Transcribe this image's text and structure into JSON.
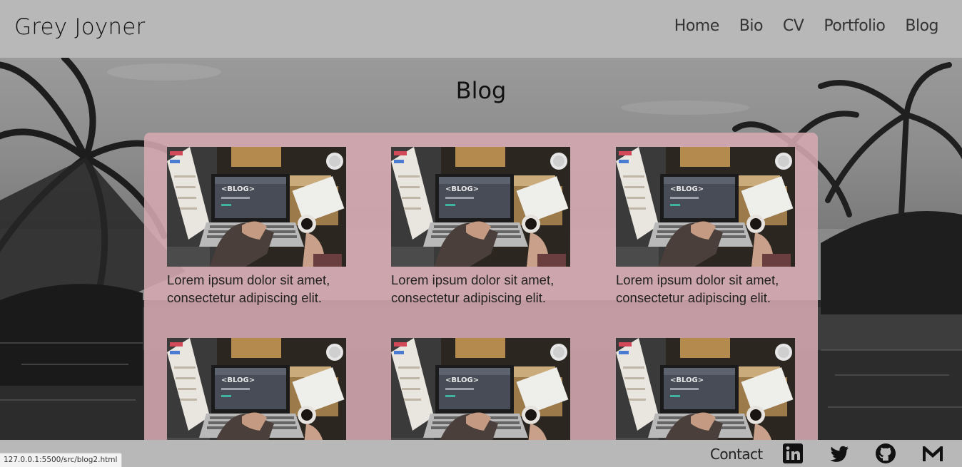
{
  "header": {
    "brand": "Grey Joyner",
    "nav": [
      "Home",
      "Bio",
      "CV",
      "Portfolio",
      "Blog"
    ]
  },
  "page": {
    "title": "Blog"
  },
  "posts": [
    {
      "thumb_label": "<BLOG>",
      "caption": "Lorem ipsum dolor sit amet, consectetur adipiscing elit."
    },
    {
      "thumb_label": "<BLOG>",
      "caption": "Lorem ipsum dolor sit amet, consectetur adipiscing elit."
    },
    {
      "thumb_label": "<BLOG>",
      "caption": "Lorem ipsum dolor sit amet, consectetur adipiscing elit."
    },
    {
      "thumb_label": "<BLOG>",
      "caption": ""
    },
    {
      "thumb_label": "<BLOG>",
      "caption": ""
    },
    {
      "thumb_label": "<BLOG>",
      "caption": ""
    }
  ],
  "footer": {
    "contact_label": "Contact",
    "social": [
      "linkedin-icon",
      "twitter-icon",
      "github-icon",
      "gmail-icon"
    ]
  },
  "status_bar": {
    "url": "127.0.0.1:5500/src/blog2.html"
  },
  "colors": {
    "header_bg": "#b8b8b8",
    "panel_bg": "#d6a8b0"
  }
}
